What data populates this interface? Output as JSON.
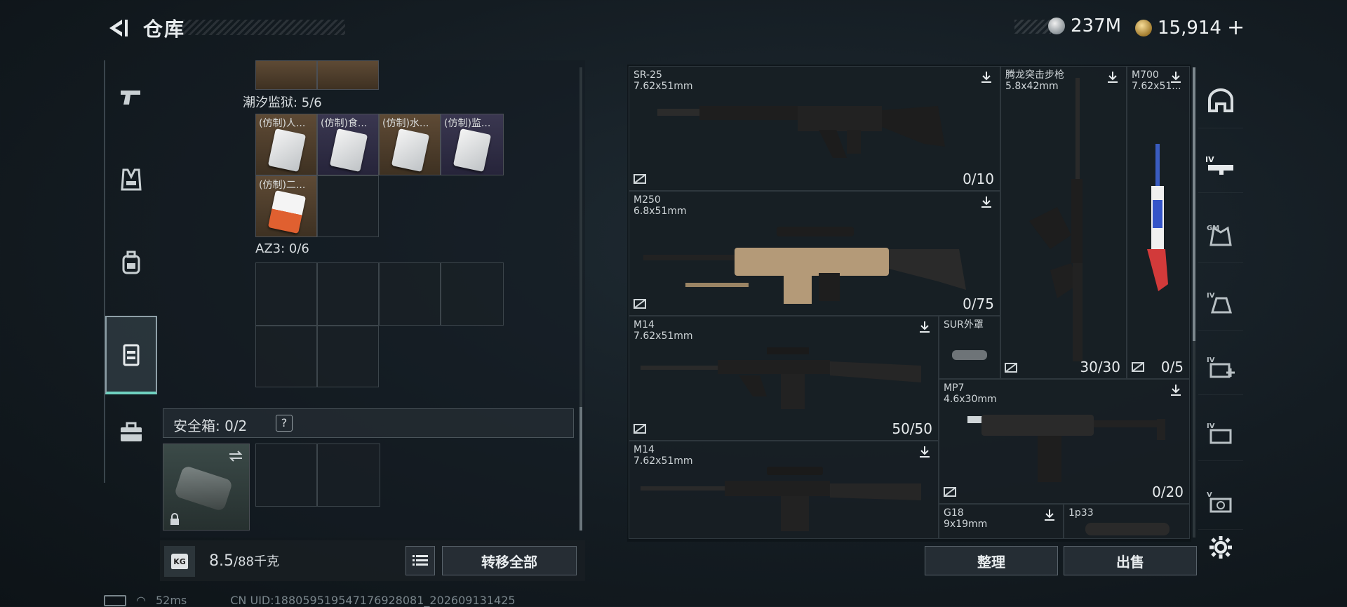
{
  "header": {
    "title": "仓库"
  },
  "currency": {
    "silver": "237M",
    "gold": "15,914",
    "add": "+"
  },
  "left_nav": [
    {
      "icon": "pistol-icon"
    },
    {
      "icon": "vest-icon"
    },
    {
      "icon": "backpack-icon"
    },
    {
      "icon": "container-icon"
    },
    {
      "icon": "briefcase-icon"
    }
  ],
  "inventory": {
    "section1_label": "潮汐监狱: 5/6",
    "section1_items": [
      "(仿制)人...",
      "(仿制)食...",
      "(仿制)水...",
      "(仿制)监...",
      "(仿制)二..."
    ],
    "section2_label": "AZ3: 0/6",
    "safebox_label": "安全箱: 0/2",
    "safebox_help": "?",
    "weight_icon_text": "KG",
    "weight_current": "8.5",
    "weight_max": "/88千克",
    "transfer_all": "转移全部"
  },
  "stash": {
    "weapons": [
      {
        "name": "SR-25",
        "caliber": "7.62x51mm",
        "count": "0/10"
      },
      {
        "name": "M250",
        "caliber": "6.8x51mm",
        "count": "0/75"
      },
      {
        "name": "M14",
        "caliber": "7.62x51mm",
        "count": "50/50"
      },
      {
        "name": "M14",
        "caliber": "7.62x51mm",
        "count": ""
      },
      {
        "name": "腾龙突击步枪",
        "caliber": "5.8x42mm",
        "count": "30/30"
      },
      {
        "name": "M700",
        "caliber": "7.62x51...",
        "count": "0/5"
      },
      {
        "name": "SUR外罩",
        "caliber": "",
        "count": ""
      },
      {
        "name": "MP7",
        "caliber": "4.6x30mm",
        "count": "0/20"
      },
      {
        "name": "G18",
        "caliber": "9x19mm",
        "count": ""
      },
      {
        "name": "1p33",
        "caliber": "",
        "count": ""
      }
    ],
    "organize": "整理",
    "sell": "出售"
  },
  "right_nav": [
    {
      "icon": "helmet-icon"
    },
    {
      "icon": "rifle-filter-icon",
      "tag": "IV"
    },
    {
      "icon": "armor-filter-icon",
      "tag": "GM"
    },
    {
      "icon": "helmet-filter-icon",
      "tag": "IV"
    },
    {
      "icon": "medical-filter-icon",
      "tag": "IV"
    },
    {
      "icon": "docs-filter-icon",
      "tag": "IV"
    },
    {
      "icon": "misc-filter-icon",
      "tag": "V"
    }
  ],
  "status": {
    "ping": "52ms",
    "uid": "CN UID:18805951954717692808​1_202609131425"
  },
  "colors": {
    "accent": "#6fd2c0",
    "brown_rarity": "#5e4a35",
    "purple_rarity": "#3a3750"
  }
}
